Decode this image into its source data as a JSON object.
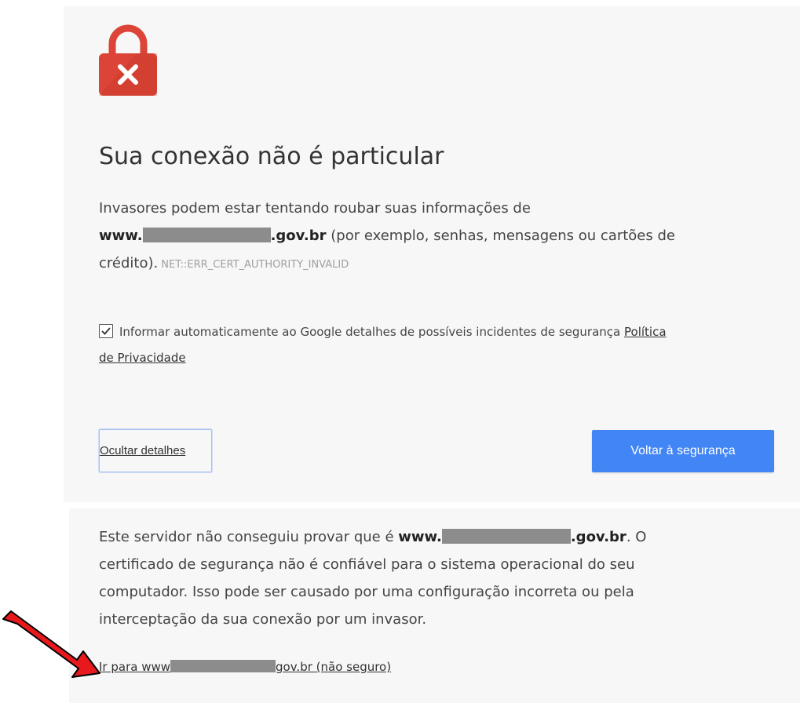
{
  "page": {
    "title": "Sua conexão não é particular",
    "intro": {
      "line1": "Invasores podem estar tentando roubar suas informações de",
      "host_prefix": "www.",
      "host_suffix": ".gov.br",
      "line2_rest": " (por exemplo, senhas, mensagens ou cartões de",
      "line3": "crédito).",
      "error_code": "NET::ERR_CERT_AUTHORITY_INVALID"
    },
    "report": {
      "checked": true,
      "text": "Informar automaticamente ao Google detalhes de possíveis incidentes de segurança",
      "privacy_link_part1": "Política",
      "privacy_link_part2": "de Privacidade"
    },
    "buttons": {
      "hide_details": "Ocultar detalhes",
      "back_to_safety": "Voltar à segurança"
    },
    "details": {
      "line1_prefix": "Este servidor não conseguiu provar que é ",
      "host_prefix": "www.",
      "host_suffix": ".gov.br",
      "line1_suffix": ". O",
      "line2": "certificado de segurança não é confiável para o sistema operacional do seu",
      "line3": "computador. Isso pode ser causado por uma configuração incorreta ou pela",
      "line4": "interceptação da sua conexão por um invasor."
    },
    "proceed": {
      "prefix": "Ir para www",
      "suffix": "gov.br (não seguro)"
    }
  },
  "icons": {
    "lock": "lock-error-icon",
    "annotation": "red-arrow-icon"
  },
  "colors": {
    "lock_red": "#db4437",
    "button_blue": "#4285f4",
    "arrow_red": "#e8191c"
  }
}
